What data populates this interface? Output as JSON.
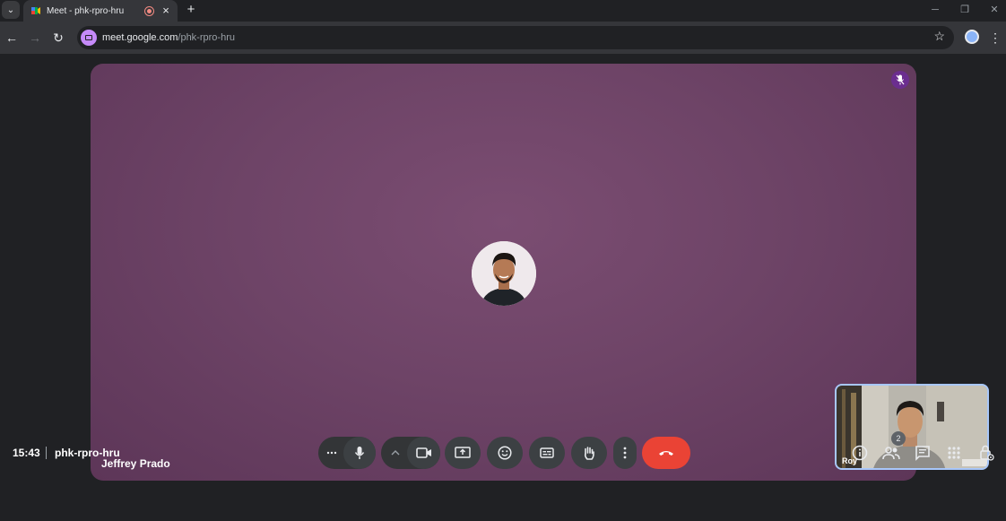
{
  "browser": {
    "tab_title": "Meet - phk-rpro-hru",
    "new_tab_label": "+",
    "url_host": "meet.google.com",
    "url_path": "/phk-rpro-hru",
    "icons": [
      "tab-search-icon",
      "recording-icon",
      "close-icon",
      "back-icon",
      "forward-icon",
      "reload-icon",
      "bookmark-star-icon",
      "profile-avatar",
      "chrome-menu-icon",
      "minimize-icon",
      "restore-icon",
      "window-close-icon"
    ]
  },
  "meeting": {
    "main_participant": "Jeffrey Prado",
    "self_participant": "Roy",
    "time": "15:43",
    "code": "phk-rpro-hru",
    "participant_count": "2",
    "main_muted": true
  },
  "controls": {
    "left_more": "more-options-icon",
    "mic": "microphone-icon",
    "camera_options": "chevron-up-icon",
    "camera": "camera-icon",
    "present": "present-screen-icon",
    "emoji": "emoji-icon",
    "captions": "captions-icon",
    "hand": "raise-hand-icon",
    "more": "more-vert-icon",
    "end": "end-call-icon"
  },
  "right_controls": [
    "info-icon",
    "people-icon",
    "chat-icon",
    "activities-icon",
    "host-controls-icon"
  ],
  "colors": {
    "tile_purple": "#6e4467",
    "end_call": "#ea4335",
    "control_bg": "#3c4043",
    "self_border": "#a8c7fa"
  }
}
